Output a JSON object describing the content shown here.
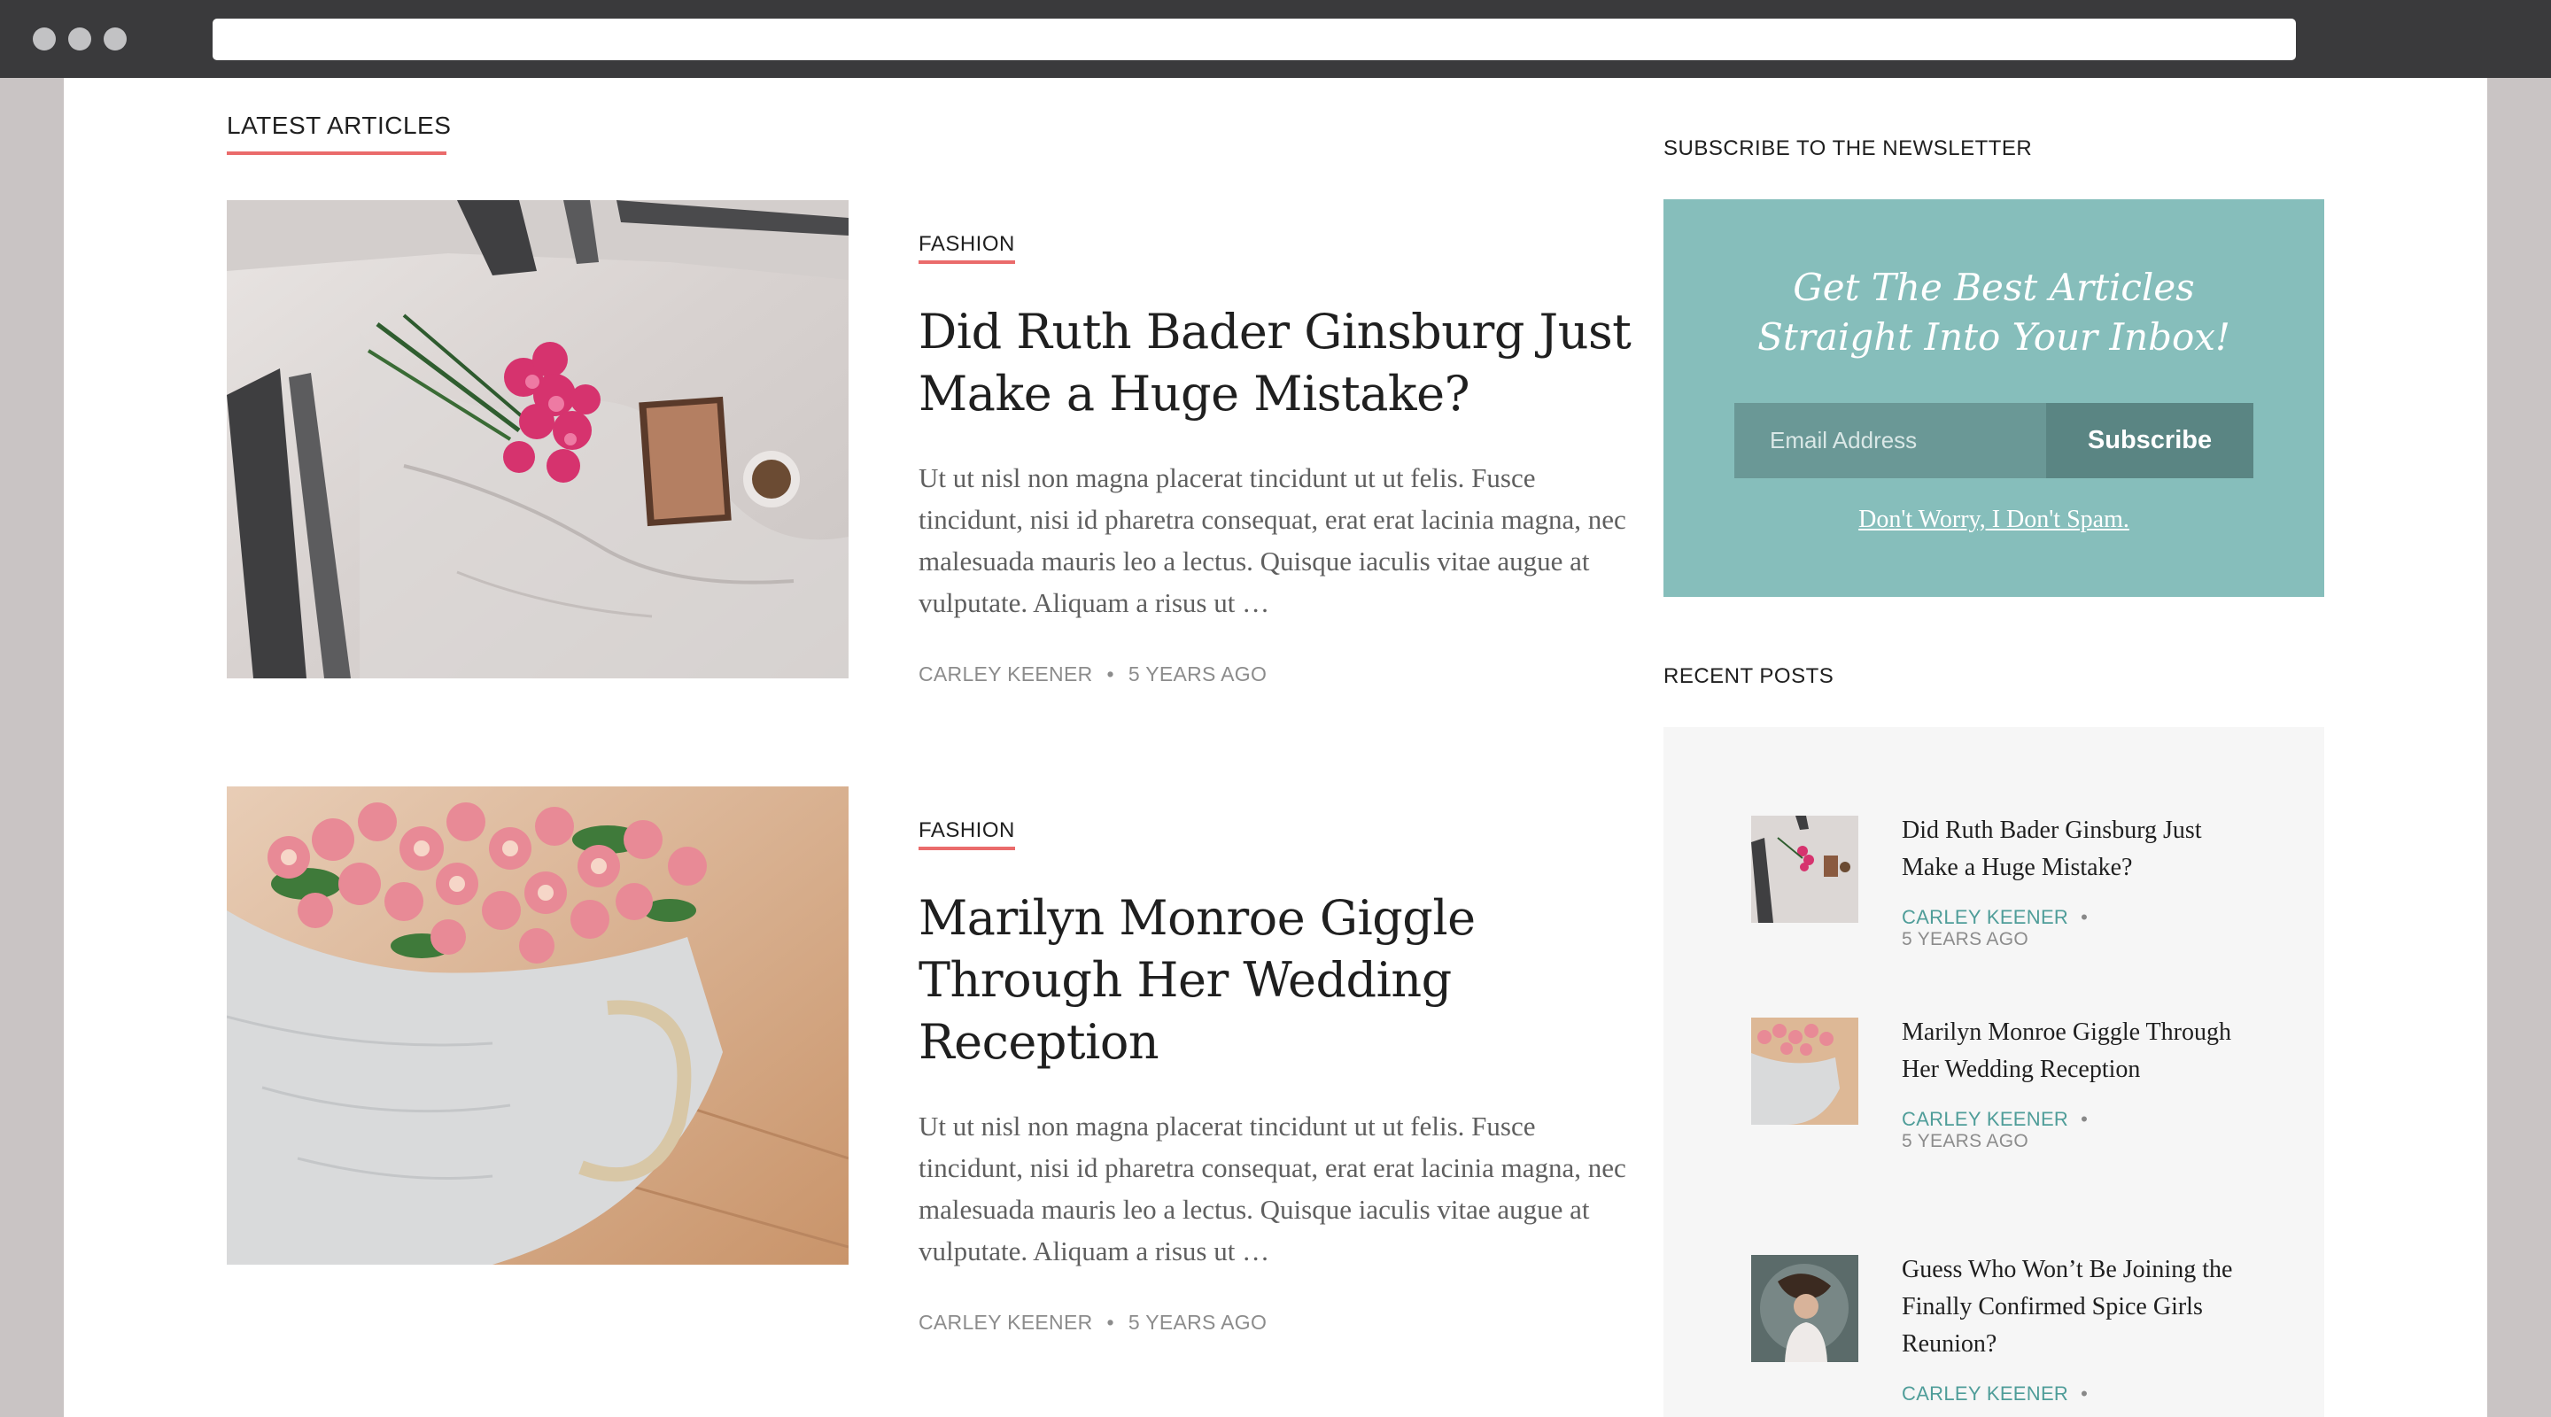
{
  "sections": {
    "latest_heading": "LATEST ARTICLES",
    "subscribe_heading": "SUBSCRIBE TO THE NEWSLETTER",
    "recent_heading": "RECENT POSTS"
  },
  "articles": [
    {
      "category": "FASHION",
      "title": "Did Ruth Bader Ginsburg Just Make a Huge Mistake?",
      "excerpt": "Ut ut nisl non magna placerat tincidunt ut ut felis. Fusce tincidunt, nisi id pharetra consequat, erat erat lacinia magna, nec malesuada mauris leo a lectus. Quisque iaculis vitae augue at vulputate. Aliquam a risus ut …",
      "author": "CARLEY KEENER",
      "separator": "•",
      "time": "5 YEARS AGO"
    },
    {
      "category": "FASHION",
      "title": "Marilyn Monroe Giggle Through Her Wedding Reception",
      "excerpt": "Ut ut nisl non magna placerat tincidunt ut ut felis. Fusce tincidunt, nisi id pharetra consequat, erat erat lacinia magna, nec malesuada mauris leo a lectus. Quisque iaculis vitae augue at vulputate. Aliquam a risus ut …",
      "author": "CARLEY KEENER",
      "separator": "•",
      "time": "5 YEARS AGO"
    }
  ],
  "newsletter": {
    "title_line1": "Get The Best Articles",
    "title_line2": "Straight Into Your Inbox!",
    "email_placeholder": "Email Address",
    "subscribe_label": "Subscribe",
    "nospam_label": "Don't Worry, I Don't Spam."
  },
  "recent_posts": [
    {
      "title": "Did Ruth Bader Ginsburg Just Make a Huge Mistake?",
      "author": "CARLEY KEENER",
      "separator": "•",
      "time": "5 YEARS AGO"
    },
    {
      "title": "Marilyn Monroe Giggle Through Her Wedding Reception",
      "author": "CARLEY KEENER",
      "separator": "•",
      "time": "5 YEARS AGO"
    },
    {
      "title": "Guess Who Won’t Be Joining the Finally Confirmed Spice Girls Reunion?",
      "author": "CARLEY KEENER",
      "separator": "•",
      "time": ""
    }
  ],
  "colors": {
    "accent_underline": "#ea6b6b",
    "newsletter_bg": "#86bebb",
    "author_link": "#4f9d99"
  }
}
